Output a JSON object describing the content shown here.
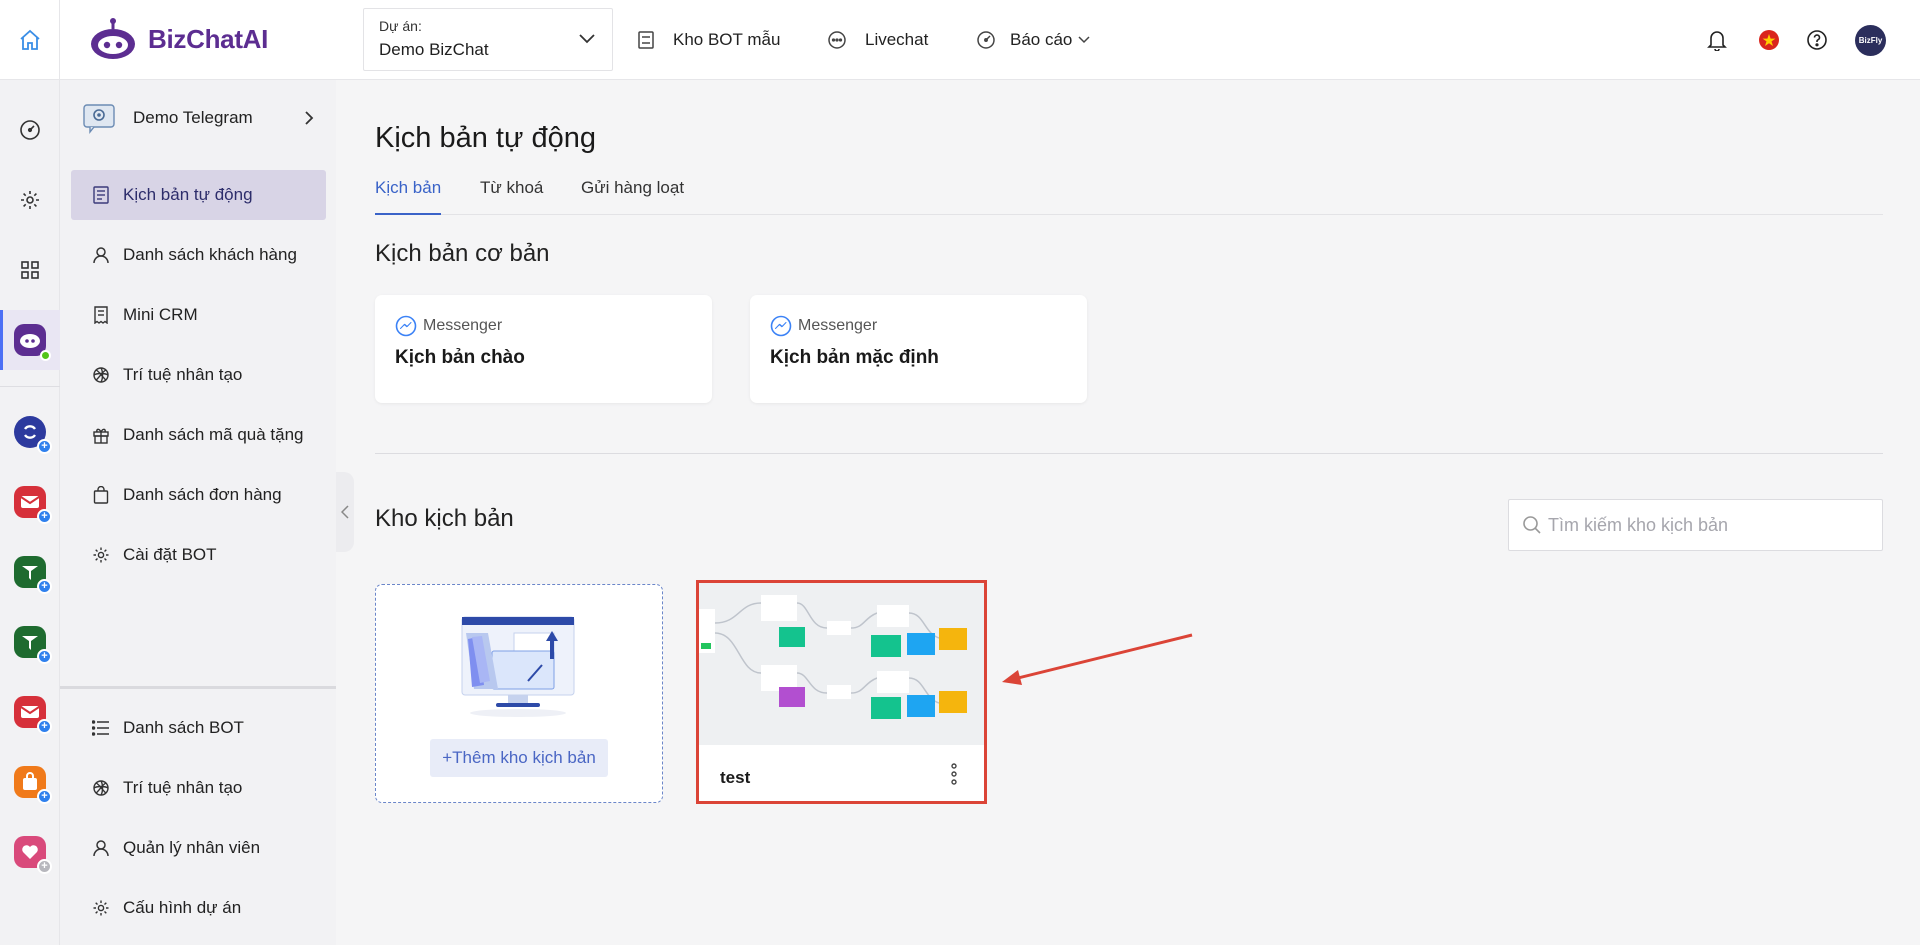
{
  "brand": {
    "name_part1": "Biz",
    "name_part2": "ChatAI",
    "color": "#5c2d91"
  },
  "header": {
    "project_label": "Dự án:",
    "project_value": "Demo BizChat",
    "nav": [
      {
        "label": "Kho BOT mẫu",
        "icon": "bot-template-icon"
      },
      {
        "label": "Livechat",
        "icon": "chat-bubble-icon"
      },
      {
        "label": "Báo cáo",
        "icon": "gauge-icon"
      }
    ],
    "avatar_text": "BizFly"
  },
  "sidebar": {
    "bot_name": "Demo Telegram",
    "items": [
      {
        "label": "Kịch bản tự động",
        "icon": "script-icon",
        "active": true
      },
      {
        "label": "Danh sách khách hàng",
        "icon": "user-icon"
      },
      {
        "label": "Mini CRM",
        "icon": "receipt-icon"
      },
      {
        "label": "Trí tuệ nhân tạo",
        "icon": "ai-icon"
      },
      {
        "label": "Danh sách mã quà tặng",
        "icon": "gift-icon"
      },
      {
        "label": "Danh sách đơn hàng",
        "icon": "bag-icon"
      },
      {
        "label": "Cài đặt BOT",
        "icon": "gear-icon"
      }
    ],
    "bottom_items": [
      {
        "label": "Danh sách BOT",
        "icon": "list-icon"
      },
      {
        "label": "Trí tuệ nhân tạo",
        "icon": "ai-icon"
      },
      {
        "label": "Quản lý nhân viên",
        "icon": "user-icon"
      },
      {
        "label": "Cấu hình dự án",
        "icon": "gear-icon"
      }
    ]
  },
  "main": {
    "title": "Kịch bản tự động",
    "tabs": [
      {
        "label": "Kịch bản",
        "active": true
      },
      {
        "label": "Từ khoá"
      },
      {
        "label": "Gửi hàng loạt"
      }
    ],
    "basic_section": "Kịch bản cơ bản",
    "basic_cards": [
      {
        "channel": "Messenger",
        "title": "Kịch bản chào"
      },
      {
        "channel": "Messenger",
        "title": "Kịch bản mặc định"
      }
    ],
    "store_section": "Kho kịch bản",
    "search_placeholder": "Tìm kiếm kho kịch bản",
    "add_label": "+Thêm kho kịch bản",
    "template": {
      "name": "test"
    }
  },
  "colors": {
    "accent": "#3a63c8",
    "highlight": "#db4437",
    "active_menu": "#d8d4e6"
  }
}
